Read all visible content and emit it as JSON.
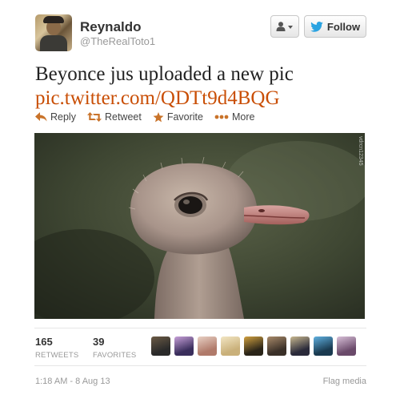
{
  "user": {
    "name": "Reynaldo",
    "handle": "@TheRealToto1"
  },
  "header": {
    "follow_label": "Follow"
  },
  "tweet": {
    "text": "Beyonce jus uploaded a new pic",
    "link": "pic.twitter.com/QDTt9d4BQG"
  },
  "actions": [
    {
      "label": "Reply",
      "icon": "reply-arrow"
    },
    {
      "label": "Retweet",
      "icon": "retweet"
    },
    {
      "label": "Favorite",
      "icon": "star"
    },
    {
      "label": "More",
      "icon": "ellipsis"
    }
  ],
  "media": {
    "watermark": "vdrcn12345"
  },
  "stats": {
    "retweets": {
      "count": "165",
      "label": "RETWEETS"
    },
    "favorites": {
      "count": "39",
      "label": "FAVORITES"
    }
  },
  "favoriters": [
    {
      "colors": [
        "#2a2a2a",
        "#6b5a45"
      ]
    },
    {
      "colors": [
        "#3a2e5c",
        "#c7a0d8"
      ]
    },
    {
      "colors": [
        "#b07a6a",
        "#e8d0c4"
      ]
    },
    {
      "colors": [
        "#c9b07a",
        "#f2e6c4"
      ]
    },
    {
      "colors": [
        "#2a2418",
        "#d0a040"
      ]
    },
    {
      "colors": [
        "#3a3028",
        "#a88a6a"
      ]
    },
    {
      "colors": [
        "#2a2a3a",
        "#c8b890"
      ]
    },
    {
      "colors": [
        "#1a3a50",
        "#60b0e0"
      ]
    },
    {
      "colors": [
        "#6a4a6a",
        "#d8c0d8"
      ]
    }
  ],
  "footer": {
    "timestamp": "1:18 AM - 8 Aug 13",
    "flag_label": "Flag media"
  },
  "colors": {
    "link": "#c94e05",
    "twitter_blue": "#2ba3e1",
    "action_orange": "#c9732a"
  }
}
